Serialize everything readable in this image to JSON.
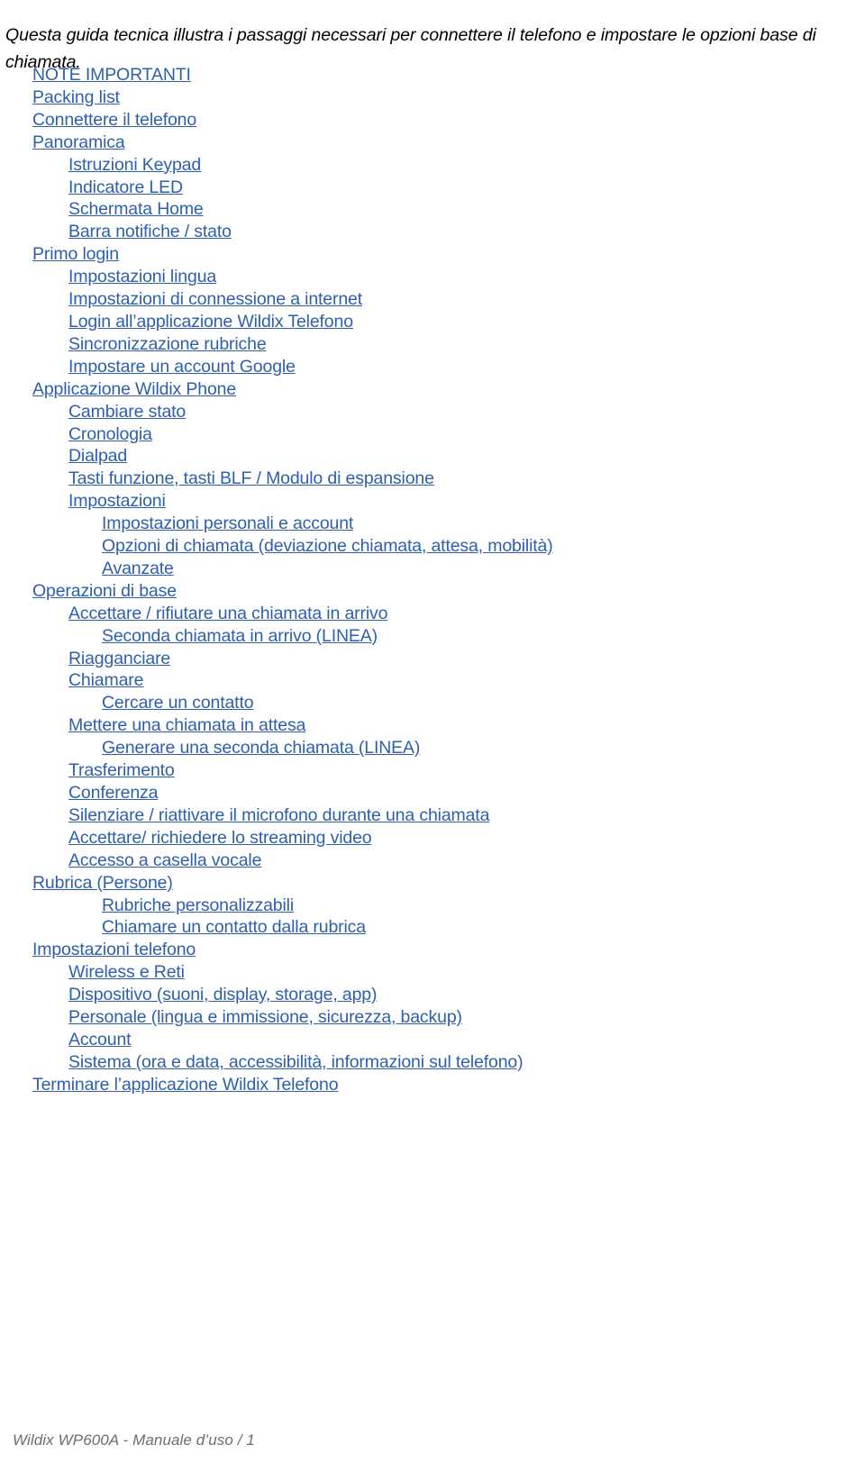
{
  "document": {
    "intro_paragraph": "Questa guida tecnica illustra i passaggi necessari per connettere il telefono e impostare le opzioni base di chiamata.",
    "footer_text": "Wildix WP600A - Manuale d’uso / 1",
    "link_color": "#2e5fad",
    "text_color": "#000000",
    "footer_color": "#6d6d6d"
  },
  "toc": {
    "entries": [
      {
        "label": "NOTE IMPORTANTI",
        "level": 0
      },
      {
        "label": "Packing list",
        "level": 0
      },
      {
        "label": "Connettere il telefono",
        "level": 0
      },
      {
        "label": "Panoramica",
        "level": 0
      },
      {
        "label": "Istruzioni Keypad",
        "level": 1
      },
      {
        "label": "Indicatore LED",
        "level": 1
      },
      {
        "label": "Schermata Home",
        "level": 1
      },
      {
        "label": "Barra notifiche / stato",
        "level": 1
      },
      {
        "label": "Primo login",
        "level": 0
      },
      {
        "label": "Impostazioni lingua",
        "level": 1
      },
      {
        "label": "Impostazioni di connessione a internet",
        "level": 1
      },
      {
        "label": "Login all’applicazione Wildix Telefono",
        "level": 1
      },
      {
        "label": "Sincronizzazione rubriche",
        "level": 1
      },
      {
        "label": "Impostare un account Google",
        "level": 1
      },
      {
        "label": "Applicazione Wildix Phone",
        "level": 0
      },
      {
        "label": "Cambiare stato",
        "level": 1
      },
      {
        "label": "Cronologia",
        "level": 1
      },
      {
        "label": "Dialpad",
        "level": 1
      },
      {
        "label": "Tasti funzione, tasti BLF / Modulo di espansione",
        "level": 1
      },
      {
        "label": "Impostazioni",
        "level": 1
      },
      {
        "label": "Impostazioni personali e account",
        "level": 2
      },
      {
        "label": "Opzioni di chiamata (deviazione chiamata, attesa, mobilità)",
        "level": 2
      },
      {
        "label": "Avanzate",
        "level": 2
      },
      {
        "label": "Operazioni di base",
        "level": 0
      },
      {
        "label": "Accettare / rifiutare una chiamata in arrivo",
        "level": 1
      },
      {
        "label": "Seconda chiamata in arrivo (LINEA)",
        "level": 2
      },
      {
        "label": "Riagganciare",
        "level": 1
      },
      {
        "label": "Chiamare",
        "level": 1
      },
      {
        "label": "Cercare un contatto",
        "level": 2
      },
      {
        "label": "Mettere una chiamata in attesa",
        "level": 1
      },
      {
        "label": "Generare una seconda chiamata (LINEA)",
        "level": 2
      },
      {
        "label": "Trasferimento",
        "level": 1
      },
      {
        "label": "Conferenza",
        "level": 1
      },
      {
        "label": "Silenziare / riattivare il microfono durante una chiamata",
        "level": 1
      },
      {
        "label": "Accettare/ richiedere lo streaming video",
        "level": 1
      },
      {
        "label": "Accesso a casella vocale",
        "level": 1
      },
      {
        "label": "Rubrica (Persone)",
        "level": 0
      },
      {
        "label": "Rubriche personalizzabili",
        "level": 2
      },
      {
        "label": "Chiamare un contatto dalla rubrica",
        "level": 2
      },
      {
        "label": "Impostazioni telefono",
        "level": 0
      },
      {
        "label": "Wireless e Reti",
        "level": 1
      },
      {
        "label": "Dispositivo (suoni, display, storage, app)",
        "level": 1
      },
      {
        "label": "Personale (lingua e immissione, sicurezza, backup)",
        "level": 1
      },
      {
        "label": "Account",
        "level": 1
      },
      {
        "label": "Sistema (ora e data, accessibilità, informazioni sul telefono)",
        "level": 1
      },
      {
        "label": "Terminare l’applicazione Wildix Telefono",
        "level": 0
      }
    ]
  }
}
